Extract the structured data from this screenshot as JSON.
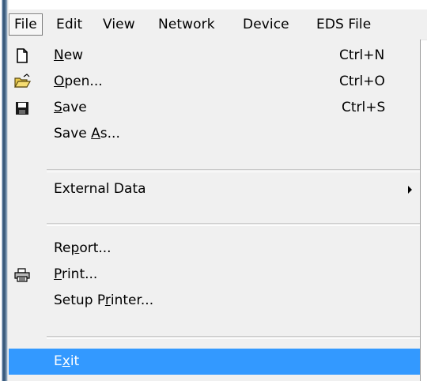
{
  "menubar": {
    "items": [
      {
        "label": "File",
        "active": true
      },
      {
        "label": "Edit",
        "active": false
      },
      {
        "label": "View",
        "active": false
      },
      {
        "label": "Network",
        "active": false
      },
      {
        "label": "Device",
        "active": false
      },
      {
        "label": "EDS File",
        "active": false
      }
    ]
  },
  "file_menu": {
    "items": [
      {
        "pre": "",
        "mnemonic": "N",
        "post": "ew",
        "shortcut": "Ctrl+N",
        "icon": "new-document-icon"
      },
      {
        "pre": "",
        "mnemonic": "O",
        "post": "pen...",
        "shortcut": "Ctrl+O",
        "icon": "open-folder-icon"
      },
      {
        "pre": "",
        "mnemonic": "S",
        "post": "ave",
        "shortcut": "Ctrl+S",
        "icon": "save-floppy-icon"
      },
      {
        "pre": "Save ",
        "mnemonic": "A",
        "post": "s...",
        "shortcut": "",
        "icon": ""
      },
      {
        "pre": "External Data",
        "mnemonic": "",
        "post": "",
        "shortcut": "",
        "icon": "",
        "has_submenu": true
      },
      {
        "pre": "Re",
        "mnemonic": "p",
        "post": "ort...",
        "shortcut": "",
        "icon": ""
      },
      {
        "pre": "",
        "mnemonic": "P",
        "post": "rint...",
        "shortcut": "",
        "icon": "printer-icon"
      },
      {
        "pre": "Setup P",
        "mnemonic": "r",
        "post": "inter...",
        "shortcut": "",
        "icon": ""
      },
      {
        "pre": "E",
        "mnemonic": "x",
        "post": "it",
        "shortcut": "",
        "icon": "",
        "highlighted": true
      }
    ]
  },
  "colors": {
    "menu_background": "#f0f0f0",
    "highlight": "#3399ff",
    "highlight_text": "#ffffff"
  }
}
